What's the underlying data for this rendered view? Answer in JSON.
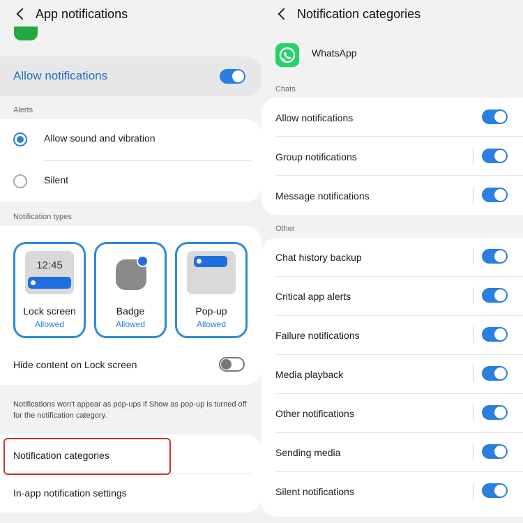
{
  "left": {
    "header": {
      "title": "App notifications"
    },
    "allow": {
      "label": "Allow notifications",
      "on": true
    },
    "alerts": {
      "section": "Alerts",
      "options": [
        {
          "label": "Allow sound and vibration",
          "selected": true
        },
        {
          "label": "Silent",
          "selected": false
        }
      ]
    },
    "types": {
      "section": "Notification types",
      "tiles": [
        {
          "name": "Lock screen",
          "status": "Allowed",
          "clock": "12:45"
        },
        {
          "name": "Badge",
          "status": "Allowed"
        },
        {
          "name": "Pop-up",
          "status": "Allowed"
        }
      ]
    },
    "hide_content": {
      "label": "Hide content on Lock screen",
      "on": false
    },
    "footnote": "Notifications won't appear as pop-ups if Show as pop-up is turned off for the notification category.",
    "links": [
      {
        "label": "Notification categories",
        "highlighted": true
      },
      {
        "label": "In-app notification settings"
      }
    ]
  },
  "right": {
    "header": {
      "title": "Notification categories"
    },
    "app": {
      "name": "WhatsApp",
      "icon": "whatsapp-icon"
    },
    "chats": {
      "section": "Chats",
      "rows": [
        {
          "label": "Allow notifications",
          "on": true
        },
        {
          "label": "Group notifications",
          "on": true
        },
        {
          "label": "Message notifications",
          "on": true
        }
      ]
    },
    "other": {
      "section": "Other",
      "rows": [
        {
          "label": "Chat history backup",
          "on": true
        },
        {
          "label": "Critical app alerts",
          "on": true
        },
        {
          "label": "Failure notifications",
          "on": true
        },
        {
          "label": "Media playback",
          "on": true
        },
        {
          "label": "Other notifications",
          "on": true
        },
        {
          "label": "Sending media",
          "on": true
        },
        {
          "label": "Silent notifications",
          "on": true
        }
      ]
    }
  },
  "colors": {
    "accent": "#2a7fe0",
    "tile_border": "#2f8ad6",
    "highlight_border": "#c0392b",
    "whatsapp": "#25d366"
  }
}
